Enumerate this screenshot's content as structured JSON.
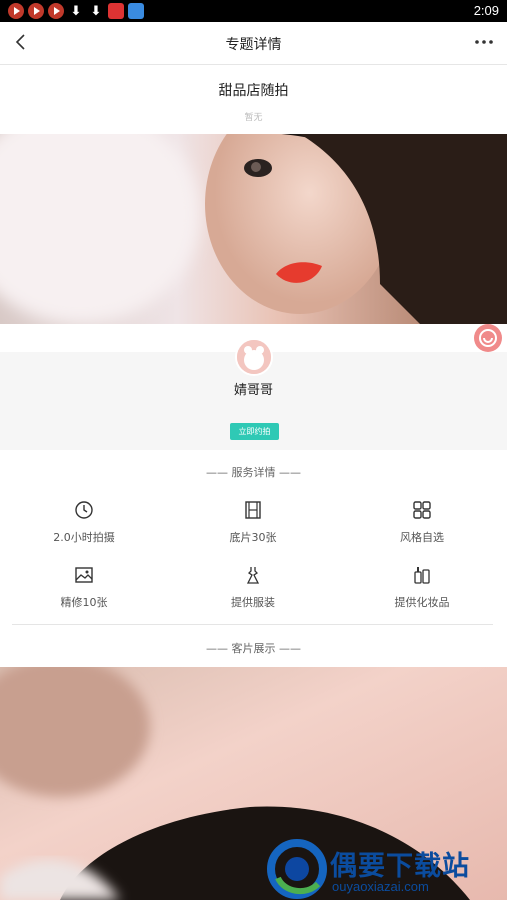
{
  "status_bar": {
    "time": "2:09",
    "icons": [
      "play-icon",
      "play-icon",
      "play-icon",
      "download-icon",
      "download-icon",
      "app-icon",
      "app-icon"
    ]
  },
  "nav": {
    "title": "专题详情",
    "back_icon": "chevron-left-icon",
    "more_icon": "more-dots-icon"
  },
  "topic": {
    "title": "甜品店随拍",
    "subtitle": "暂无"
  },
  "photographer": {
    "name": "婧哥哥",
    "book_label": "立即约拍"
  },
  "services": {
    "heading": "—— 服务详情 ——",
    "items": [
      {
        "icon": "clock-icon",
        "label": "2.0小时拍摄"
      },
      {
        "icon": "film-icon",
        "label": "底片30张"
      },
      {
        "icon": "grid-icon",
        "label": "风格自选"
      },
      {
        "icon": "image-icon",
        "label": "精修10张"
      },
      {
        "icon": "dress-icon",
        "label": "提供服装"
      },
      {
        "icon": "cosmetics-icon",
        "label": "提供化妆品"
      }
    ]
  },
  "gallery": {
    "heading": "—— 客片展示 ——"
  },
  "watermark": {
    "name": "偶要下载站",
    "url": "ouyaoxiazai.com"
  },
  "colors": {
    "accent": "#2fc9b5",
    "statusbar": "#000000",
    "watermark": "#0b4c9e"
  }
}
